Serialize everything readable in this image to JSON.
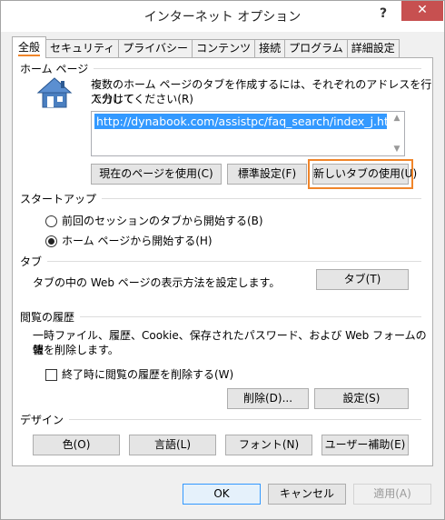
{
  "window": {
    "title": "インターネット オプション",
    "help_label": "?",
    "close_label": "✕"
  },
  "tabs": [
    {
      "label": "全般",
      "active": true
    },
    {
      "label": "セキュリティ"
    },
    {
      "label": "プライバシー"
    },
    {
      "label": "コンテンツ"
    },
    {
      "label": "接続"
    },
    {
      "label": "プログラム"
    },
    {
      "label": "詳細設定"
    }
  ],
  "home_page": {
    "group_label": "ホーム ページ",
    "description_line1": "複数のホーム ページのタブを作成するには、それぞれのアドレスを行で分けて",
    "description_line2": "入力してください(R)",
    "url_value": "http://dynabook.com/assistpc/faq_search/index_j.htm",
    "use_current_label": "現在のページを使用(C)",
    "use_default_label": "標準設定(F)",
    "use_new_tab_label": "新しいタブの使用(U)",
    "icon": "house-icon"
  },
  "startup": {
    "group_label": "スタートアップ",
    "option1_label": "前回のセッションのタブから開始する(B)",
    "option2_label": "ホーム ページから開始する(H)",
    "selected": 2
  },
  "tabs_section": {
    "group_label": "タブ",
    "description": "タブの中の Web ページの表示方法を設定します。",
    "tabs_button_label": "タブ(T)"
  },
  "history": {
    "group_label": "閲覧の履歴",
    "description_line1": "一時ファイル、履歴、Cookie、保存されたパスワード、および Web フォームの情",
    "description_line2": "報を削除します。",
    "delete_on_exit_label": "終了時に閲覧の履歴を削除する(W)",
    "delete_on_exit_checked": false,
    "delete_button_label": "削除(D)...",
    "settings_button_label": "設定(S)"
  },
  "appearance": {
    "group_label": "デザイン",
    "colors_label": "色(O)",
    "languages_label": "言語(L)",
    "fonts_label": "フォント(N)",
    "accessibility_label": "ユーザー補助(E)"
  },
  "footer": {
    "ok_label": "OK",
    "cancel_label": "キャンセル",
    "apply_label": "適用(A)"
  },
  "colors": {
    "accent_highlight": "#f0852a",
    "selection": "#3399ff",
    "close_button": "#c75050"
  }
}
